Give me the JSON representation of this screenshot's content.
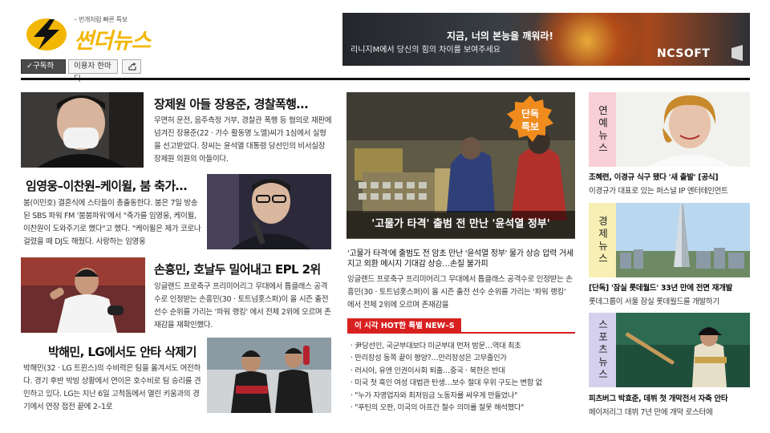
{
  "header": {
    "tagline": "– 번개처럼 빠른 특보",
    "site_name": "썬더뉴스",
    "subscribe_label": "구독하기",
    "opinion_label": "이용자 한마디",
    "share_icon": "share-icon"
  },
  "ad": {
    "headline": "지금, 너의 본능을 깨워라!",
    "subline": "리니지M에서 당신의 힘의 차이를 보여주세요",
    "brand": "NCSOFT"
  },
  "left_articles": [
    {
      "title": "장제원 아들 장용준, 경찰폭행…",
      "summary": "무면허 운전, 음주측정 거부, 경찰관 폭행 등 혐의로 재판에 넘겨진 장용준(22 · 가수 활동명 노엘)씨가 1심에서 실형을 선고받았다. 장씨는 윤석열 대통령 당선인의 비서실장 장제원 의원의 아들이다."
    },
    {
      "title": "임영웅–이찬원–케이윌, 붐 축가…",
      "summary": "붐(이민호) 결혼식에 스타들이 총출동한다. 붐은 7일 방송된 SBS 파워 FM '붐붐파워'에서 \"축가를 임영웅, 케이윌, 이찬원이 도와주기로 했다\"고 했다. \"케이윌은 제가 코로나 걸렸을 때 DJ도 해줬다. 사랑하는 임영웅"
    },
    {
      "title": "손흥민, 호날두 밀어내고 EPL 2위",
      "summary": "잉글랜드 프로축구 프리미어리그 무대에서 톱클래스 공격수로 인정받는 손흥민(30 · 토트넘홋스퍼)이 올 시즌 출전 선수 순위를 가리는 '파워 랭킹' 에서 전체 2위에 오르며 존재감을 재확인했다."
    },
    {
      "title": "박해민, LG에서도 안타 삭제기",
      "summary": "박해민(32 · LG 트윈스)의 수비력은 팀을 옮겨서도 여전하다. 경기 후반 박빙 상황에서 연이은 호수비로 팀 승리를 견인하고 있다. LG는 지난 6일 고척돔에서 열린 키움과의 경기에서 연장 접전 끝에 2–1로"
    }
  ],
  "center": {
    "badge_line1": "단독",
    "badge_line2": "특보",
    "feature_caption": "'고물가 타격' 출범 전 만난 '윤석열 정부'",
    "headline": "'고물가 타격'에 출범도 전 암초 만난 '윤석열 정부' 물가 상승 압력 거세지고 외환 메시지 기대감 상승…손질 불가피",
    "summary": "잉글랜드 프로축구 프리미어리그 무대에서 톱클래스 공격수로 인정받는 손흥민(30 · 토트넘홋스퍼)이 올 시즌 출전 선수 순위를 가리는 '파워 랭킹' 에서 전체 2위에 오르며 존재감을",
    "hot_label": "이 시각 HOT한 특별 NEW–S",
    "hot_items": [
      "· 尹당선인, 국군부대보다 미군부대 먼저 방문…역대 최초",
      "· 만리장성 동쪽 끝이 평양?…만리장성은 고무줄인가",
      "· 러시아, 유엔 인권이사회 퇴출…중국 · 북한은 반대",
      "· 미국 첫 흑인 여성 대법관 탄생…보수 절대 우위 구도는 변함 없",
      "· \"누가 자영업자와 최저임금 노동자를 싸우게 만들었나\"",
      "· \"푸틴의 오판, 미국의 아프간 철수 의미를 잘못 해석했다\""
    ]
  },
  "right": [
    {
      "category": "연예뉴스",
      "category_color": "#f8cfd6",
      "title": "조혜련, 이경규 식구 됐다 '새 출발' [공식]",
      "subtitle": "이경규가 대표로 있는 퍼스널 IP 엔터테인먼트"
    },
    {
      "category": "경제뉴스",
      "category_color": "#f7efb4",
      "title": "[단독] '잠실 롯데월드' 33년 만에 전면 재개발",
      "subtitle": "롯데그룹이 서울 잠실 롯데월드를 개발하기"
    },
    {
      "category": "스포츠뉴스",
      "category_color": "#d6d0ef",
      "title": "피츠버그 박효준, 데뷔 첫 개막전서 자축 안타",
      "subtitle": "메이저리그 데뷔 7년 만에 개막 로스터에"
    }
  ],
  "colors": {
    "logo_yellow": "#f2b705",
    "hot_red": "#d92020",
    "badge_orange": "#f08c1e"
  }
}
